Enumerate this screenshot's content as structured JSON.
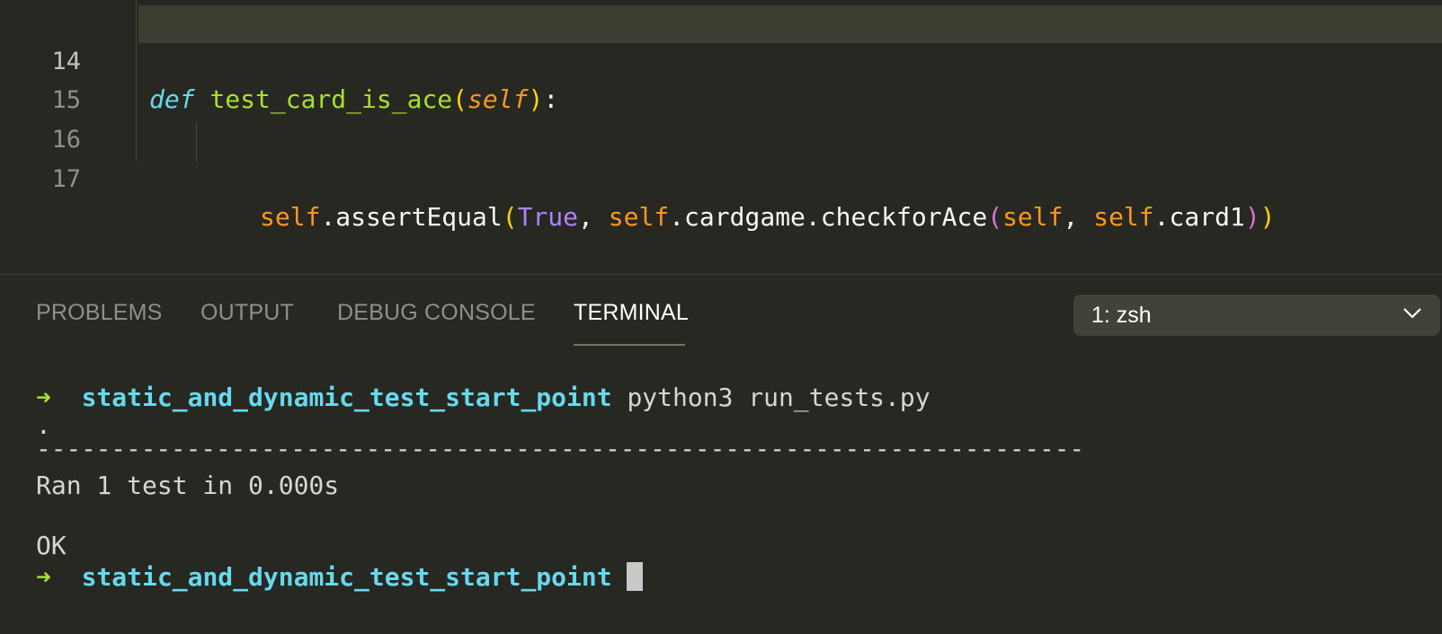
{
  "editor": {
    "lines": [
      {
        "number": "14",
        "def_kw": "def",
        "func_name": "test_card_is_ace",
        "open_paren": "(",
        "param": "self",
        "close_paren": ")",
        "colon": ":"
      },
      {
        "number": "15"
      },
      {
        "number": "16"
      },
      {
        "number": "17",
        "self1": "self",
        "t1": ".assertEqual",
        "p1": "(",
        "const": "True",
        "t2": ", ",
        "self2": "self",
        "t3": ".cardgame.checkforAce",
        "p2": "(",
        "self3": "self",
        "t4": ", ",
        "self4": "self",
        "t5": ".card1",
        "p3": ")",
        "p4": ")"
      }
    ]
  },
  "panel": {
    "tabs": [
      {
        "label": "PROBLEMS",
        "active": false
      },
      {
        "label": "OUTPUT",
        "active": false
      },
      {
        "label": "DEBUG CONSOLE",
        "active": false
      },
      {
        "label": "TERMINAL",
        "active": true
      }
    ],
    "terminal_select": {
      "value": "1: zsh"
    }
  },
  "terminal": {
    "prompt_arrow": "➜",
    "cwd": "static_and_dynamic_test_start_point",
    "command": "python3 run_tests.py",
    "dot": ".",
    "separator": "----------------------------------------------------------------------",
    "ran": "Ran 1 test in 0.000s",
    "ok": "OK"
  },
  "colors": {
    "background": "#272822",
    "keyword": "#66d9ef",
    "function": "#a6e22e",
    "self": "#fd971f",
    "constant": "#ae81ff",
    "prompt_arrow": "#a6e22e",
    "prompt_dir": "#66d9ef"
  }
}
